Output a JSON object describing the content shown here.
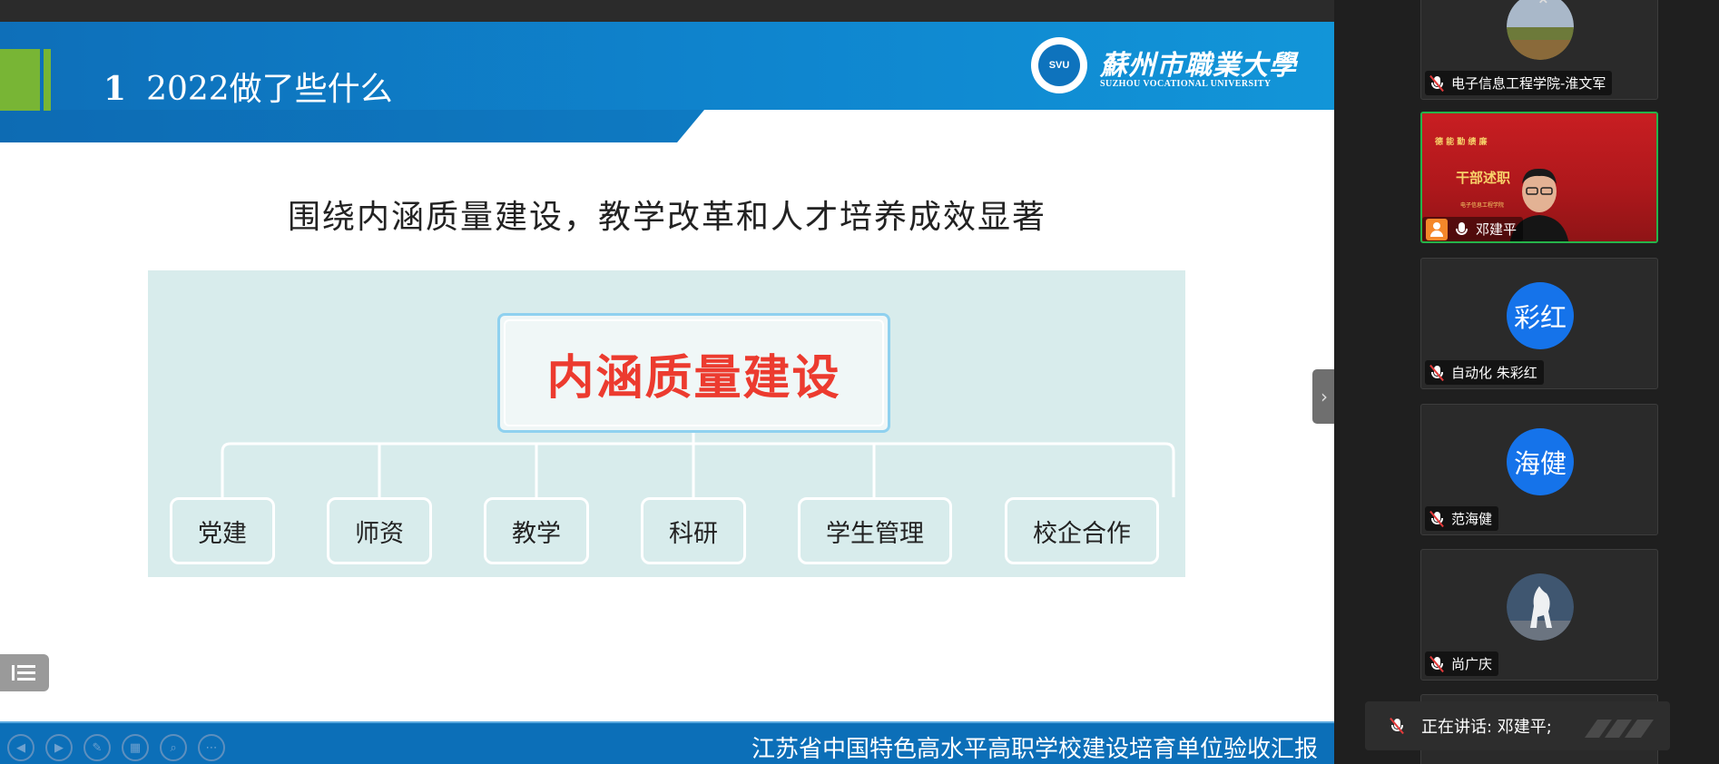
{
  "slide": {
    "section_number": "1",
    "title": "2022做了些什么",
    "subtitle": "围绕内涵质量建设，教学改革和人才培养成效显著",
    "logo": {
      "emblem_text": "SVU",
      "cn_name": "蘇州市職業大學",
      "en_name": "SUZHOU VOCATIONAL UNIVERSITY"
    },
    "diagram": {
      "root": "内涵质量建设",
      "children": [
        "党建",
        "师资",
        "教学",
        "科研",
        "学生管理",
        "校企合作"
      ]
    },
    "footer_text": "江苏省中国特色高水平高职学校建设培育单位验收汇报",
    "controls": [
      "prev-icon",
      "next-icon",
      "pen-icon",
      "slides-icon",
      "zoom-icon",
      "more-icon"
    ]
  },
  "participants": [
    {
      "name": "电子信息工程学院-淮文军",
      "muted": true,
      "avatar": "photo-landscape"
    },
    {
      "name": "邓建平",
      "muted": false,
      "avatar": "video",
      "host": true,
      "video_banner_top": "德 能 勤 绩 廉",
      "video_banner_title": "干部述职",
      "video_banner_sub": "电子信息工程学院"
    },
    {
      "name": "自动化 朱彩红",
      "muted": true,
      "avatar": "text",
      "avatar_text": "彩红"
    },
    {
      "name": "范海健",
      "muted": true,
      "avatar": "text",
      "avatar_text": "海健"
    },
    {
      "name": "尚广庆",
      "muted": true,
      "avatar": "photo-horse"
    }
  ],
  "speaking": {
    "text": "正在讲话: 邓建平;"
  },
  "colors": {
    "header_blue": "#0b86d0",
    "accent_green": "#78b535",
    "root_red": "#ec3b2f",
    "avatar_blue": "#1573ea",
    "active_border": "#26b34a"
  }
}
